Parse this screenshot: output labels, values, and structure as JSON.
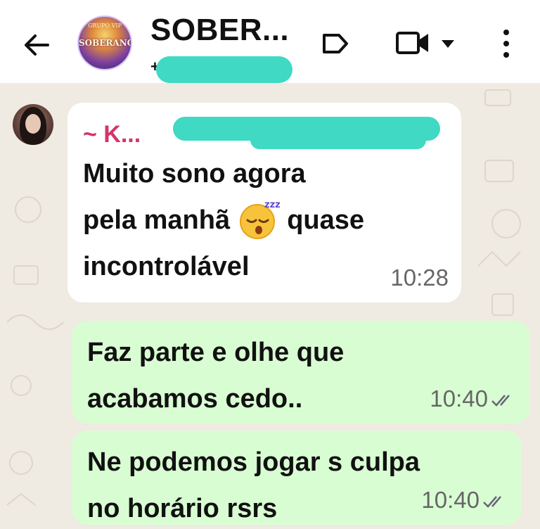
{
  "header": {
    "title": "SOBER...",
    "subtitle": "+• ...2...",
    "avatar_text": "SOBERANOS",
    "avatar_small_text": "GRUPO VIP"
  },
  "icons": {
    "back": "arrow-left-icon",
    "label": "label-tag-icon",
    "video": "video-call-icon",
    "caret": "caret-down-icon",
    "more": "more-vert-icon"
  },
  "messages": [
    {
      "direction": "in",
      "sender": "~ K...",
      "lines": [
        "Muito sono agora",
        "pela manhã",
        "quase",
        "incontrolável"
      ],
      "time": "10:28"
    },
    {
      "direction": "out",
      "lines": [
        "Faz parte e olhe que",
        "acabamos cedo.."
      ],
      "time": "10:40"
    },
    {
      "direction": "out",
      "lines": [
        "Ne podemos jogar s culpa",
        "no horário rsrs"
      ],
      "time": "10:40"
    }
  ],
  "colors": {
    "incoming_bubble": "#ffffff",
    "outgoing_bubble": "#d9fdd3",
    "sender_name": "#d6336c",
    "redaction": "#3fd9c4",
    "wallpaper": "#efeae2"
  }
}
